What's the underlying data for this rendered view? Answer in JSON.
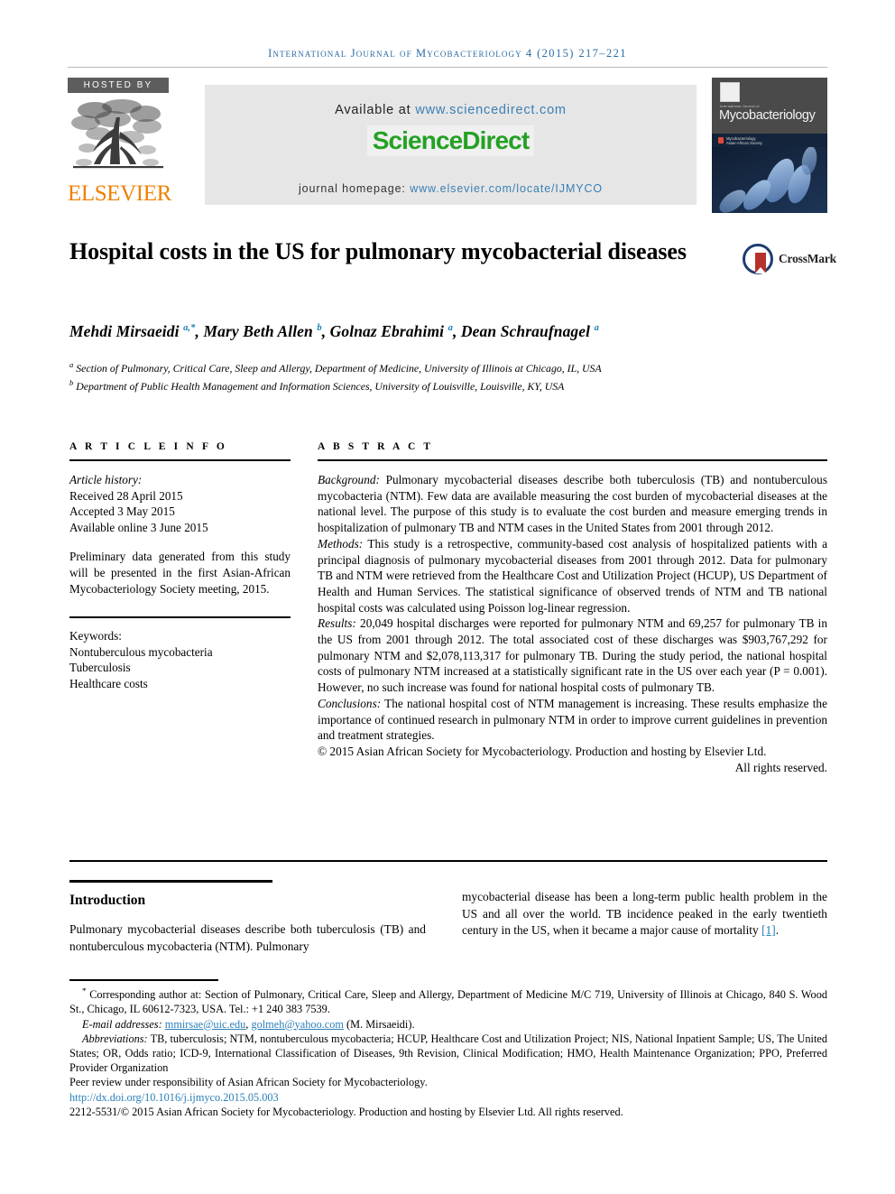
{
  "running_head": {
    "journal": "International Journal of Mycobacteriology",
    "volume_year_pages": "4 (2015) 217–221"
  },
  "masthead": {
    "hosted_by": "HOSTED BY",
    "publisher": "ELSEVIER",
    "available_label": "Available at",
    "available_url": "www.sciencedirect.com",
    "sciencedirect_logo": "ScienceDirect",
    "homepage_label": "journal homepage:",
    "homepage_url": "www.elsevier.com/locate/IJMYCO",
    "cover": {
      "supertitle": "International Journal of",
      "title": "Mycobacteriology",
      "strip_text": "Mycobacteriology\nAsian-African Society"
    }
  },
  "article": {
    "title": "Hospital costs in the US for pulmonary mycobacterial diseases",
    "crossmark_label": "CrossMark",
    "authors_html": "Mehdi Mirsaeidi <sup class=\"sup-aff\">a,*</sup>, Mary Beth Allen <sup class=\"sup-aff\">b</sup>, Golnaz Ebrahimi <sup class=\"sup-aff\">a</sup>, Dean Schraufnagel <sup class=\"sup-aff\">a</sup>",
    "affiliation_a": "Section of Pulmonary, Critical Care, Sleep and Allergy, Department of Medicine, University of Illinois at Chicago, IL, USA",
    "affiliation_b": "Department of Public Health Management and Information Sciences, University of Louisville, Louisville, KY, USA"
  },
  "article_info": {
    "heading": "A R T I C L E    I N F O",
    "history_label": "Article history:",
    "received": "Received 28 April 2015",
    "accepted": "Accepted 3 May 2015",
    "available_online": "Available online 3 June 2015",
    "note": "Preliminary data generated from this study will be presented in the first Asian-African Mycobacteriology Society meeting, 2015.",
    "keywords_label": "Keywords:",
    "keywords": [
      "Nontuberculous mycobacteria",
      "Tuberculosis",
      "Healthcare costs"
    ]
  },
  "abstract": {
    "heading": "A B S T R A C T",
    "background_label": "Background:",
    "background": "Pulmonary mycobacterial diseases describe both tuberculosis (TB) and nontuberculous mycobacteria (NTM). Few data are available measuring the cost burden of mycobacterial diseases at the national level. The purpose of this study is to evaluate the cost burden and measure emerging trends in hospitalization of pulmonary TB and NTM cases in the United States from 2001 through 2012.",
    "methods_label": "Methods:",
    "methods": "This study is a retrospective, community-based cost analysis of hospitalized patients with a principal diagnosis of pulmonary mycobacterial diseases from 2001 through 2012. Data for pulmonary TB and NTM were retrieved from the Healthcare Cost and Utilization Project (HCUP), US Department of Health and Human Services. The statistical significance of observed trends of NTM and TB national hospital costs was calculated using Poisson log-linear regression.",
    "results_label": "Results:",
    "results": "20,049 hospital discharges were reported for pulmonary NTM and 69,257 for pulmonary TB in the US from 2001 through 2012. The total associated cost of these discharges was $903,767,292 for pulmonary NTM and $2,078,113,317 for pulmonary TB. During the study period, the national hospital costs of pulmonary NTM increased at a statistically significant rate in the US over each year (P = 0.001). However, no such increase was found for national hospital costs of pulmonary TB.",
    "conclusions_label": "Conclusions:",
    "conclusions": "The national hospital cost of NTM management is increasing. These results emphasize the importance of continued research in pulmonary NTM in order to improve current guidelines in prevention and treatment strategies.",
    "copyright_line1": "© 2015 Asian African Society for Mycobacteriology. Production and hosting by Elsevier Ltd.",
    "copyright_line2": "All rights reserved."
  },
  "body": {
    "intro_heading": "Introduction",
    "intro_col1": "Pulmonary mycobacterial diseases describe both tuberculosis (TB) and nontuberculous mycobacteria (NTM). Pulmonary",
    "intro_col2_pre": "mycobacterial disease has been a long-term public health problem in the US and all over the world. TB incidence peaked in the early twentieth century in the US, when it became a major cause of mortality ",
    "intro_col2_citation": "[1]",
    "intro_col2_post": "."
  },
  "footnotes": {
    "corresponding": "Corresponding author at: Section of Pulmonary, Critical Care, Sleep and Allergy, Department of Medicine M/C 719, University of Illinois at Chicago, 840 S. Wood St., Chicago, IL 60612-7323, USA. Tel.: +1 240 383 7539.",
    "email_label": "E-mail addresses:",
    "email1": "mmirsae@uic.edu",
    "email2": "golmeh@yahoo.com",
    "email_owner": "(M. Mirsaeidi).",
    "abbreviations_label": "Abbreviations:",
    "abbreviations": "TB, tuberculosis; NTM, nontuberculous mycobacteria; HCUP, Healthcare Cost and Utilization Project; NIS, National Inpatient Sample; US, The United States; OR, Odds ratio; ICD-9, International Classification of Diseases, 9th Revision, Clinical Modification; HMO, Health Maintenance Organization; PPO, Preferred Provider Organization",
    "peer_review": "Peer review under responsibility of Asian African Society for Mycobacteriology.",
    "doi": "http://dx.doi.org/10.1016/j.ijmyco.2015.05.003",
    "issn_line": "2212-5531/© 2015 Asian African Society for Mycobacteriology. Production and hosting by Elsevier Ltd. All rights reserved."
  },
  "colors": {
    "link": "#2b7fb8",
    "running_head": "#2b6ca3",
    "elsevier_orange": "#f08000",
    "sciencedirect_green": "#24a124",
    "crossmark_blue": "#1f3d6e",
    "crossmark_red": "#b5312b"
  }
}
